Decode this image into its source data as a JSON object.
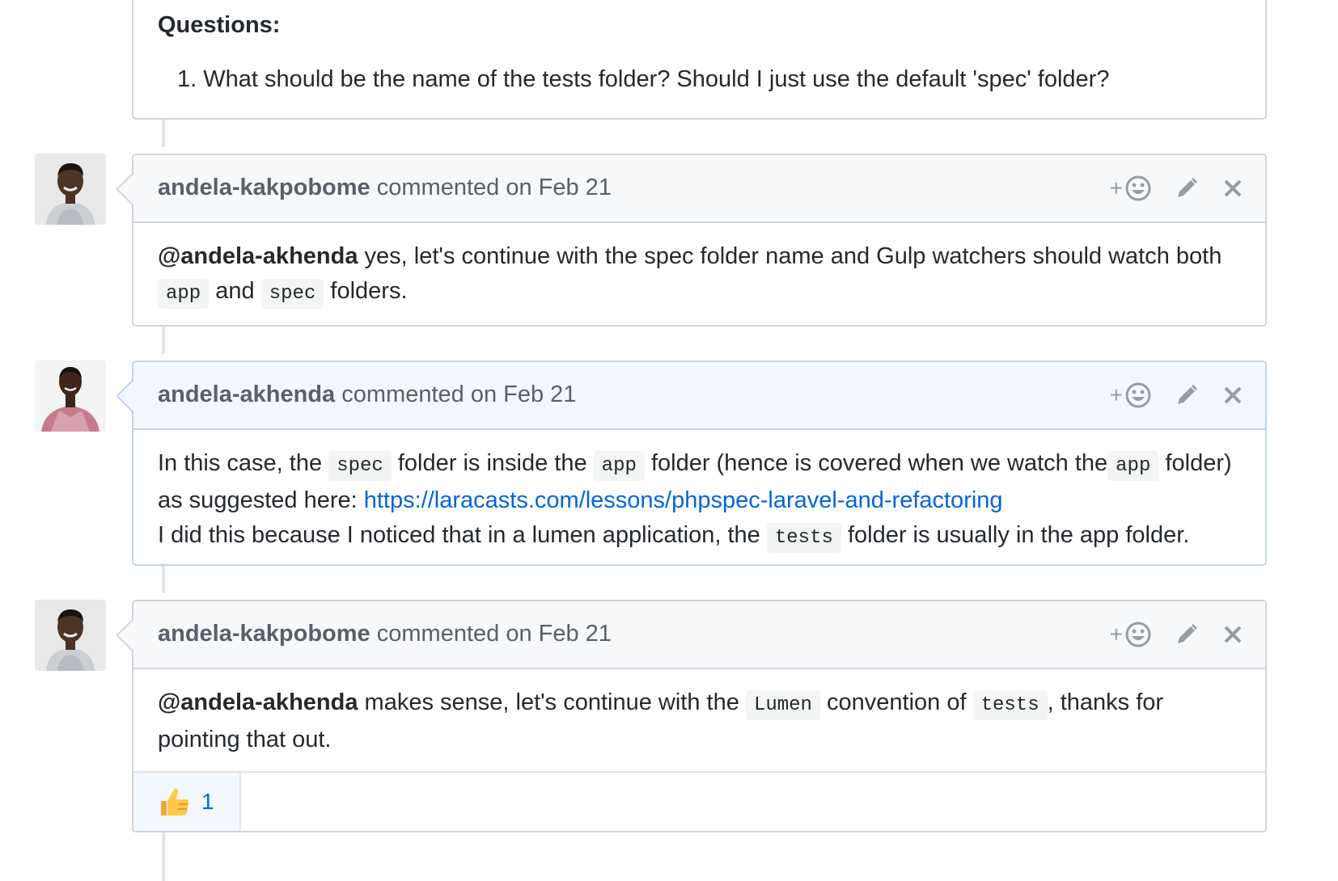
{
  "top_comment": {
    "questions_heading": "Questions:",
    "question_number": "1.",
    "question_text": "What should be the name of the tests folder? Should I just use the default 'spec' folder?"
  },
  "comments": [
    {
      "author": "andela-kakpobome",
      "meta": "commented on Feb 21",
      "mention": "@andela-akhenda",
      "text_1": "yes, let's continue with the spec folder name and Gulp watchers should watch both",
      "code_1": "app",
      "text_2": "and",
      "code_2": "spec",
      "text_3": "folders."
    },
    {
      "author": "andela-akhenda",
      "meta": "commented on Feb 21",
      "text_1": "In this case, the",
      "code_1": "spec",
      "text_2": "folder is inside the",
      "code_2": "app",
      "text_3": "folder (hence is covered when we watch the",
      "code_3": "app",
      "text_4": "folder) as suggested here:",
      "link": "https://laracasts.com/lessons/phpspec-laravel-and-refactoring",
      "text_5": "I did this because I noticed that in a lumen application, the",
      "code_4": "tests",
      "text_6": "folder is usually in the app folder."
    },
    {
      "author": "andela-kakpobome",
      "meta": "commented on Feb 21",
      "mention": "@andela-akhenda",
      "text_1": "makes sense, let's continue with the",
      "code_1": "Lumen",
      "text_2": "convention of",
      "code_2": "tests",
      "text_3": ", thanks for pointing that out.",
      "reaction_emoji": "thumbs-up",
      "reaction_count": "1"
    }
  ],
  "actions": {
    "add_reaction_icon": "smiley-plus-icon",
    "edit_icon": "pencil-icon",
    "delete_icon": "x-icon",
    "plus": "+",
    "close_glyph": "✕"
  },
  "colors": {
    "link": "#0366d6",
    "header_bg": "#f6f8fa",
    "self_header_bg": "#f1f8ff",
    "border": "#d1d5da"
  }
}
